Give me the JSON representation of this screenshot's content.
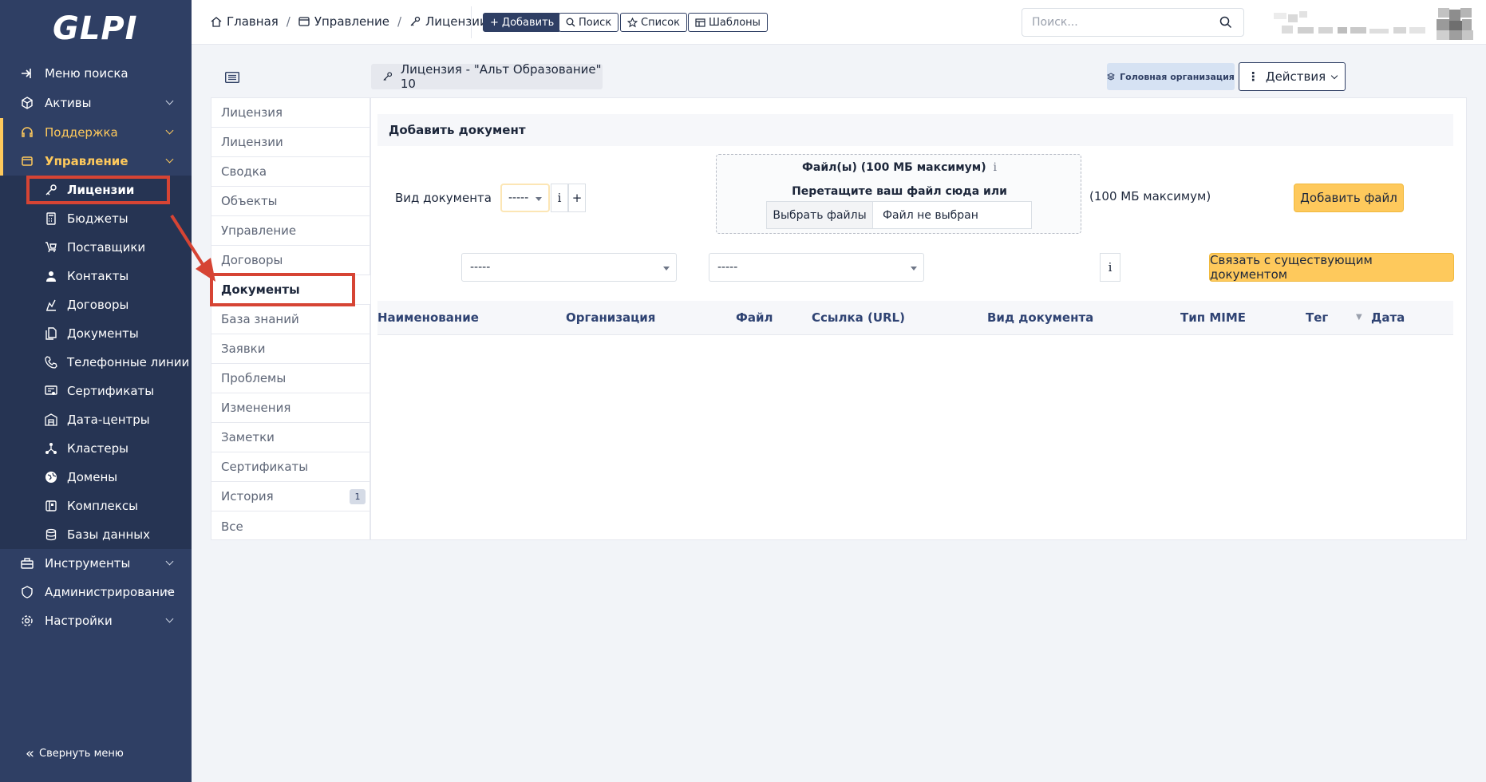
{
  "app": {
    "logo_text": "GLPI"
  },
  "sidebar": {
    "items": [
      {
        "label": "Меню поиска",
        "icon": "search-menu-icon"
      },
      {
        "label": "Активы",
        "icon": "assets-icon"
      },
      {
        "label": "Поддержка",
        "icon": "headset-icon"
      },
      {
        "label": "Управление",
        "icon": "management-icon"
      }
    ],
    "submenu": [
      {
        "label": "Лицензии",
        "icon": "key-icon"
      },
      {
        "label": "Бюджеты",
        "icon": "calculator-icon"
      },
      {
        "label": "Поставщики",
        "icon": "supplier-icon"
      },
      {
        "label": "Контакты",
        "icon": "user-icon"
      },
      {
        "label": "Договоры",
        "icon": "contract-icon"
      },
      {
        "label": "Документы",
        "icon": "documents-icon"
      },
      {
        "label": "Телефонные линии",
        "icon": "phone-icon"
      },
      {
        "label": "Сертификаты",
        "icon": "certificate-icon"
      },
      {
        "label": "Дата-центры",
        "icon": "datacenter-icon"
      },
      {
        "label": "Кластеры",
        "icon": "cluster-icon"
      },
      {
        "label": "Домены",
        "icon": "globe-icon"
      },
      {
        "label": "Комплексы",
        "icon": "appliance-icon"
      },
      {
        "label": "Базы данных",
        "icon": "database-icon"
      }
    ],
    "bottom_items": [
      {
        "label": "Инструменты",
        "icon": "toolbox-icon"
      },
      {
        "label": "Администрирование",
        "icon": "admin-icon"
      },
      {
        "label": "Настройки",
        "icon": "gear-icon"
      }
    ],
    "collapse_label": "Свернуть меню"
  },
  "breadcrumb": {
    "home": "Главная",
    "section": "Управление",
    "page": "Лицензии"
  },
  "toolbar": {
    "add": "Добавить",
    "search": "Поиск",
    "list": "Список",
    "templates": "Шаблоны"
  },
  "search": {
    "placeholder": "Поиск..."
  },
  "item": {
    "title": "Лицензия - \"Альт Образование\" 10",
    "org": "Головная организация",
    "actions": "Действия"
  },
  "tabs": [
    {
      "label": "Лицензия"
    },
    {
      "label": "Лицензии"
    },
    {
      "label": "Сводка"
    },
    {
      "label": "Объекты"
    },
    {
      "label": "Управление"
    },
    {
      "label": "Договоры"
    },
    {
      "label": "Документы"
    },
    {
      "label": "База знаний"
    },
    {
      "label": "Заявки"
    },
    {
      "label": "Проблемы"
    },
    {
      "label": "Изменения"
    },
    {
      "label": "Заметки"
    },
    {
      "label": "Сертификаты"
    },
    {
      "label": "История",
      "count": "1"
    },
    {
      "label": "Все"
    }
  ],
  "form": {
    "heading": "Добавить документ",
    "doc_type_label": "Вид документа",
    "doc_type_value": "-----",
    "info_glyph": "i",
    "plus_glyph": "+",
    "dropzone_title": "Файл(ы) (100 МБ максимум)",
    "dropzone_hint": "Перетащите ваш файл сюда или",
    "choose_files": "Выбрать файлы",
    "no_file": "Файл не выбран",
    "max_size": "(100 МБ максимум)",
    "add_file": "Добавить файл",
    "select_a": "-----",
    "select_b": "-----",
    "link_existing": "Связать с существующим документом"
  },
  "table": {
    "columns": [
      "Наименование",
      "Организация",
      "Файл",
      "Ссылка (URL)",
      "Вид документа",
      "Тип MIME",
      "Тег",
      "Дата"
    ],
    "sort_glyph": "▼"
  },
  "colors": {
    "sidebar": "#2f3f64",
    "accent": "#fec95c",
    "highlight": "#d64434"
  }
}
